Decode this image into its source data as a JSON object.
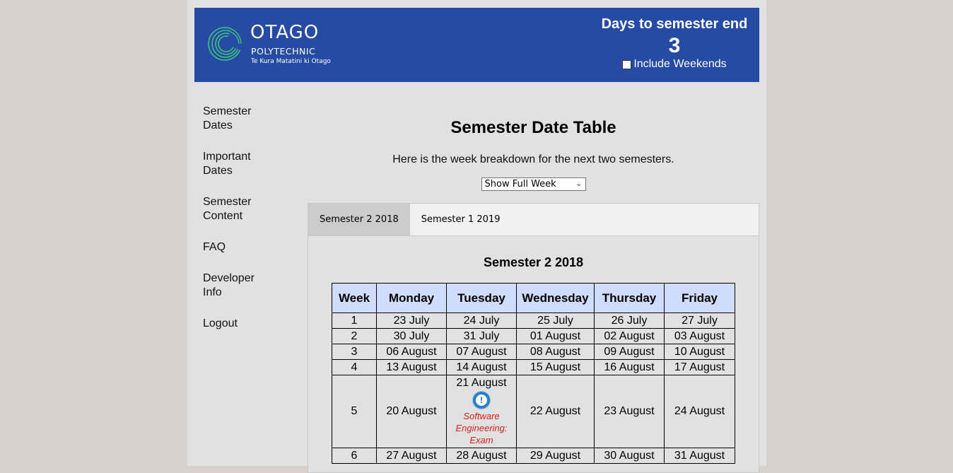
{
  "logo": {
    "name": "OTAGO",
    "sub": "POLYTECHNIC",
    "tagline": "Te Kura Matatini ki Otago"
  },
  "countdown": {
    "title": "Days to semester end",
    "value": "3",
    "checkbox_label": "Include Weekends",
    "checked": false
  },
  "nav": {
    "items": [
      {
        "label": "Semester Dates"
      },
      {
        "label": "Important Dates"
      },
      {
        "label": "Semester Content"
      },
      {
        "label": "FAQ"
      },
      {
        "label": "Developer Info"
      },
      {
        "label": "Logout"
      }
    ]
  },
  "main": {
    "title": "Semester Date Table",
    "subtitle": "Here is the week breakdown for the next two semesters.",
    "select_value": "Show Full Week"
  },
  "tabs": [
    {
      "label": "Semester 2 2018",
      "active": true
    },
    {
      "label": "Semester 1 2019",
      "active": false
    }
  ],
  "semester": {
    "title": "Semester 2 2018",
    "headers": [
      "Week",
      "Monday",
      "Tuesday",
      "Wednesday",
      "Thursday",
      "Friday"
    ],
    "rows": [
      [
        "1",
        "23 July",
        "24 July",
        "25 July",
        "26 July",
        "27 July"
      ],
      [
        "2",
        "30 July",
        "31 July",
        "01 August",
        "02 August",
        "03 August"
      ],
      [
        "3",
        "06 August",
        "07 August",
        "08 August",
        "09 August",
        "10 August"
      ],
      [
        "4",
        "13 August",
        "14 August",
        "15 August",
        "16 August",
        "17 August"
      ],
      [
        "5",
        "20 August",
        "21 August",
        "22 August",
        "23 August",
        "24 August"
      ],
      [
        "6",
        "27 August",
        "28 August",
        "29 August",
        "30 August",
        "31 August"
      ]
    ],
    "event": {
      "text_line1": "Software",
      "text_line2": "Engineering:",
      "text_line3": "Exam",
      "icon": "alert-icon",
      "color": "#d62020"
    }
  },
  "colors": {
    "header_bg": "#264ba5",
    "table_header_bg": "#cfdcfb",
    "page_bg": "#d6d2cb"
  }
}
